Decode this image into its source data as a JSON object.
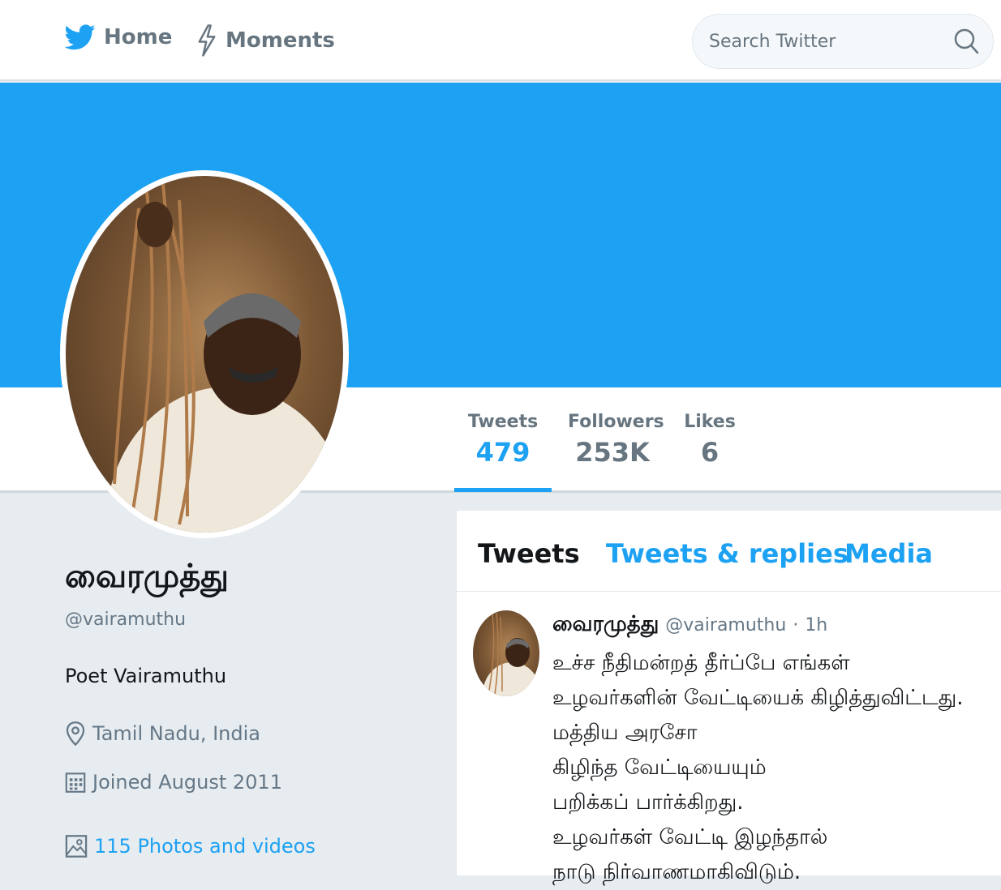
{
  "nav": {
    "home_label": "Home",
    "moments_label": "Moments",
    "search_placeholder": "Search Twitter"
  },
  "stats": {
    "tweets_label": "Tweets",
    "tweets_value": "479",
    "followers_label": "Followers",
    "followers_value": "253K",
    "likes_label": "Likes",
    "likes_value": "6"
  },
  "profile": {
    "name": "வைரமுத்து",
    "handle": "@vairamuthu",
    "bio": "Poet Vairamuthu",
    "location": "Tamil Nadu, India",
    "joined": "Joined August 2011",
    "photos_link": "115 Photos and videos"
  },
  "tabs": {
    "tweets": "Tweets",
    "replies": "Tweets & replies",
    "media": "Media"
  },
  "tweet": {
    "name": "வைரமுத்து",
    "handle": "@vairamuthu",
    "dot": "·",
    "time": "1h",
    "lines": [
      "உச்ச நீதிமன்றத் தீர்ப்பே  எங்கள்",
      "உழவர்களின் வேட்டியைக் கிழித்துவிட்டது.",
      "மத்திய அரசோ",
      "கிழிந்த வேட்டியையும்",
      "பறிக்கப் பார்க்கிறது.",
      "உழவர்கள் வேட்டி இழந்தால்",
      "நாடு நிர்வாணமாகிவிடும்."
    ]
  },
  "colors": {
    "brand": "#1da1f2",
    "banner": "#1da1f2",
    "text_primary": "#14171a",
    "text_secondary": "#657786"
  }
}
